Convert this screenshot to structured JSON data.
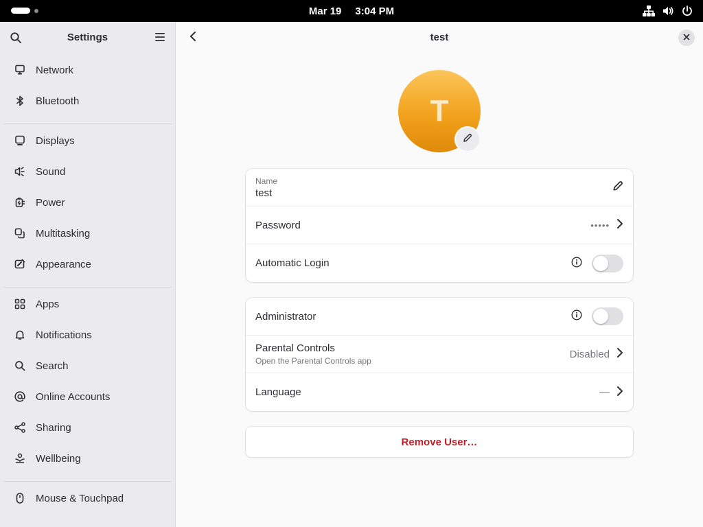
{
  "topbar": {
    "date": "Mar 19",
    "time": "3:04 PM"
  },
  "sidebar": {
    "title": "Settings",
    "groups": [
      [
        {
          "label": "Network",
          "icon": "network-icon"
        },
        {
          "label": "Bluetooth",
          "icon": "bluetooth-icon"
        }
      ],
      [
        {
          "label": "Displays",
          "icon": "display-icon"
        },
        {
          "label": "Sound",
          "icon": "sound-icon"
        },
        {
          "label": "Power",
          "icon": "power-plug-icon"
        },
        {
          "label": "Multitasking",
          "icon": "multitasking-icon"
        },
        {
          "label": "Appearance",
          "icon": "appearance-icon"
        }
      ],
      [
        {
          "label": "Apps",
          "icon": "apps-grid-icon"
        },
        {
          "label": "Notifications",
          "icon": "bell-icon"
        },
        {
          "label": "Search",
          "icon": "search-icon"
        },
        {
          "label": "Online Accounts",
          "icon": "at-sign-icon"
        },
        {
          "label": "Sharing",
          "icon": "share-icon"
        },
        {
          "label": "Wellbeing",
          "icon": "wellbeing-icon"
        }
      ],
      [
        {
          "label": "Mouse & Touchpad",
          "icon": "mouse-icon"
        }
      ]
    ]
  },
  "main": {
    "title": "test",
    "avatar_initial": "T",
    "account": {
      "name_caption": "Name",
      "name_value": "test",
      "password_label": "Password",
      "password_mask": "•••••",
      "auto_login_label": "Automatic Login",
      "auto_login_on": false
    },
    "settings": {
      "admin_label": "Administrator",
      "admin_on": false,
      "parental_label": "Parental Controls",
      "parental_sub": "Open the Parental Controls app",
      "parental_value": "Disabled",
      "language_label": "Language",
      "language_value": "—"
    },
    "remove_label": "Remove User…"
  },
  "colors": {
    "destructive": "#c01c28",
    "avatar": "#f2a21c"
  }
}
